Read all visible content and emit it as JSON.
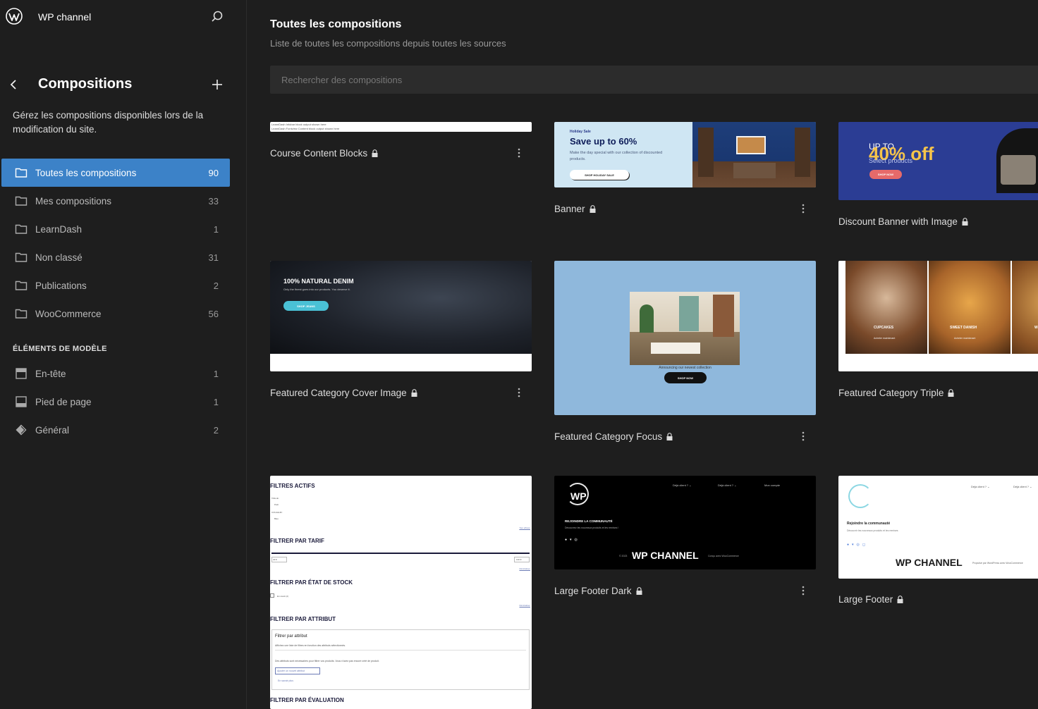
{
  "site": {
    "title": "WP channel"
  },
  "sidebar": {
    "section_title": "Compositions",
    "description": "Gérez les compositions disponibles lors de la modification du site.",
    "categories": [
      {
        "label": "Toutes les compositions",
        "count": "90",
        "active": true
      },
      {
        "label": "Mes compositions",
        "count": "33"
      },
      {
        "label": "LearnDash",
        "count": "1"
      },
      {
        "label": "Non classé",
        "count": "31"
      },
      {
        "label": "Publications",
        "count": "2"
      },
      {
        "label": "WooCommerce",
        "count": "56"
      }
    ],
    "template_parts_heading": "ÉLÉMENTS DE MODÈLE",
    "template_parts": [
      {
        "label": "En-tête",
        "count": "1",
        "icon": "header-icon"
      },
      {
        "label": "Pied de page",
        "count": "1",
        "icon": "footer-icon"
      },
      {
        "label": "Général",
        "count": "2",
        "icon": "diamond-icon"
      }
    ]
  },
  "main": {
    "title": "Toutes les compositions",
    "subtitle": "Liste de toutes les compositions depuis toutes les sources",
    "search_placeholder": "Rechercher des compositions"
  },
  "patterns": [
    {
      "name": "Course Content Blocks",
      "locked": true
    },
    {
      "name": "Banner",
      "locked": true
    },
    {
      "name": "Discount Banner with Image",
      "locked": true
    },
    {
      "name": "Featured Category Cover Image",
      "locked": true
    },
    {
      "name": "Featured Category Focus",
      "locked": true
    },
    {
      "name": "Featured Category Triple",
      "locked": true
    },
    {
      "name": "Large Footer Dark",
      "locked": true
    },
    {
      "name": "Large Footer",
      "locked": true
    }
  ],
  "previews": {
    "course": {
      "line1": "LearnDash Infobar block output shown here",
      "line2": "LearnDash Fontview Content block output shown here"
    },
    "banner": {
      "eyebrow": "Holiday Sale",
      "headline": "Save up to 60%",
      "desc": "Make the day special with our collection of discounted products.",
      "cta": "SHOP HOLIDAY SALE"
    },
    "discount": {
      "upto": "UP TO",
      "pct": "40% off",
      "sel": "Select products",
      "cta": "SHOP NOW"
    },
    "denim": {
      "title": "100% NATURAL DENIM",
      "sub": "Only the finest goes into our products. You deserve it.",
      "cta": "SHOP JEANS"
    },
    "focus": {
      "caption": "Announcing our newest collection",
      "cta": "SHOP NOW"
    },
    "triple": {
      "a": "CUPCAKES",
      "b": "SWEET DANISH",
      "c": "W",
      "a_sub": "Acheter maintenant",
      "b_sub": "Acheter maintenant"
    },
    "filters": {
      "h1": "FILTRES ACTIFS",
      "taille": "TAILLE:",
      "petit": "Petit",
      "couleur": "COULEUR:",
      "bleu": "Bleu",
      "reset1": "Tout effacer",
      "h2": "FILTRER PAR TARIF",
      "min": "40 €",
      "max": "130 €",
      "reset2": "Réinitialiser",
      "h3": "FILTRER PAR ÉTAT DE STOCK",
      "stock": "En stock (2)",
      "reset3": "Réinitialiser",
      "h4": "FILTRER PAR ATTRIBUT",
      "attr_title": "Filtrer par attribut",
      "attr_desc": "Affichez une liste de filtres en fonction des attributs sélectionnés.",
      "attr_note": "Des attributs sont nécessaires pour filtrer vos produits. Vous n'avez pas encore créé de produit.",
      "attr_btn": "Ajouter un nouvel attribut",
      "attr_more": "En savoir plus",
      "h5": "FILTRER PAR ÉVALUATION"
    },
    "lfd": {
      "logo": "WP",
      "nav_a": "Déjà client ? ⌄",
      "nav_b": "Déjà client ? ⌄",
      "nav_c": "Mon compte",
      "join": "REJOINDRE LA COMMUNAUTÉ",
      "joinsub": "Découvrez les nouveaux produits et les remises !",
      "year": "© 2023",
      "brand": "WP CHANNEL",
      "built": "Conçu avec WooCommerce"
    },
    "lf": {
      "nav_a": "Déjà client ? ⌄",
      "nav_b": "Déjà client ? ⌄",
      "join": "Rejoindre la communauté",
      "joinsub": "Découvrir les nouveaux produits et les remises",
      "brand": "WP CHANNEL",
      "built": "Propulsé par WordPress avec WooCommerce"
    }
  }
}
